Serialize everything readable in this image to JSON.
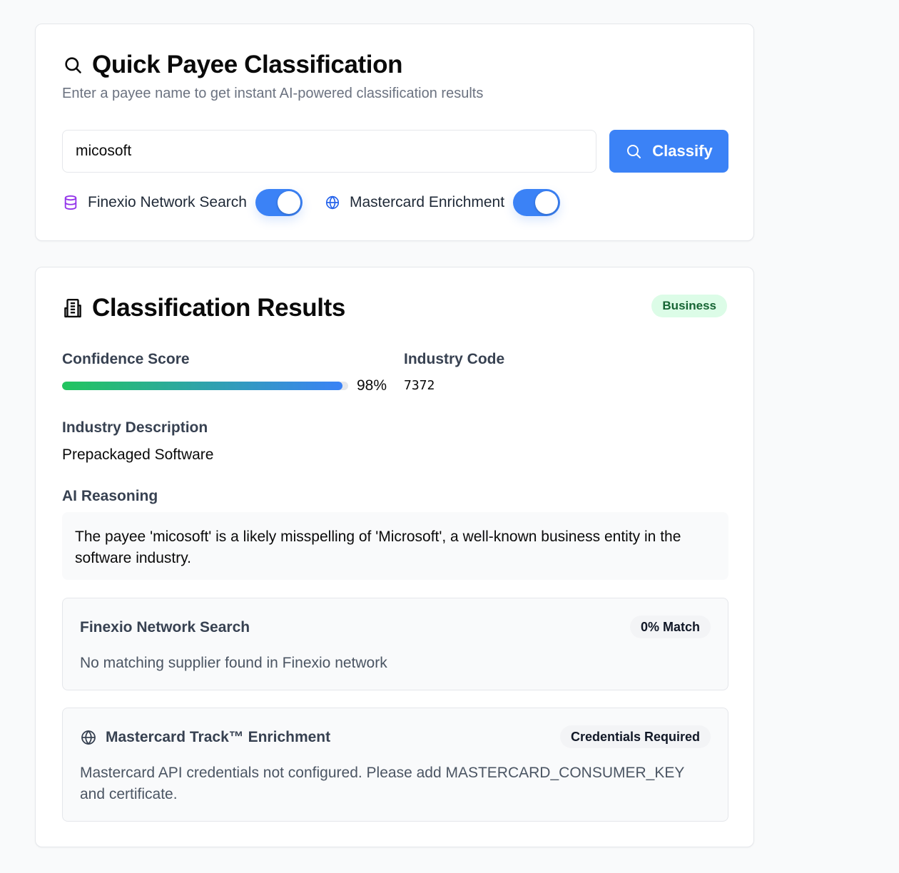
{
  "quick": {
    "title": "Quick Payee Classification",
    "title_icon": "search-icon",
    "subtitle": "Enter a payee name to get instant AI-powered classification results",
    "input_value": "micosoft",
    "classify_label": "Classify",
    "options": {
      "finexio": {
        "label": "Finexio Network Search",
        "icon": "database-icon",
        "enabled": true
      },
      "mastercard": {
        "label": "Mastercard Enrichment",
        "icon": "globe-icon",
        "enabled": true
      }
    }
  },
  "results": {
    "title": "Classification Results",
    "title_icon": "building-icon",
    "type_badge": "Business",
    "confidence_label": "Confidence Score",
    "confidence_value": 0.98,
    "confidence_text": "98%",
    "industry_code_label": "Industry Code",
    "industry_code": "7372",
    "industry_desc_label": "Industry Description",
    "industry_desc": "Prepackaged Software",
    "ai_reasoning_label": "AI Reasoning",
    "ai_reasoning": "The payee 'micosoft' is a likely misspelling of 'Microsoft', a well-known business entity in the software industry.",
    "finexio": {
      "title": "Finexio Network Search",
      "badge": "0% Match",
      "message": "No matching supplier found in Finexio network"
    },
    "mastercard": {
      "title": "Mastercard Track™ Enrichment",
      "icon": "globe-icon",
      "badge": "Credentials Required",
      "message": "Mastercard API credentials not configured. Please add MASTERCARD_CONSUMER_KEY and certificate."
    }
  },
  "colors": {
    "accent": "#3b82f6",
    "badge_business_bg": "#dcfce7",
    "badge_business_text": "#166534",
    "database_icon": "#9333ea",
    "globe_icon_blue": "#2563eb"
  }
}
